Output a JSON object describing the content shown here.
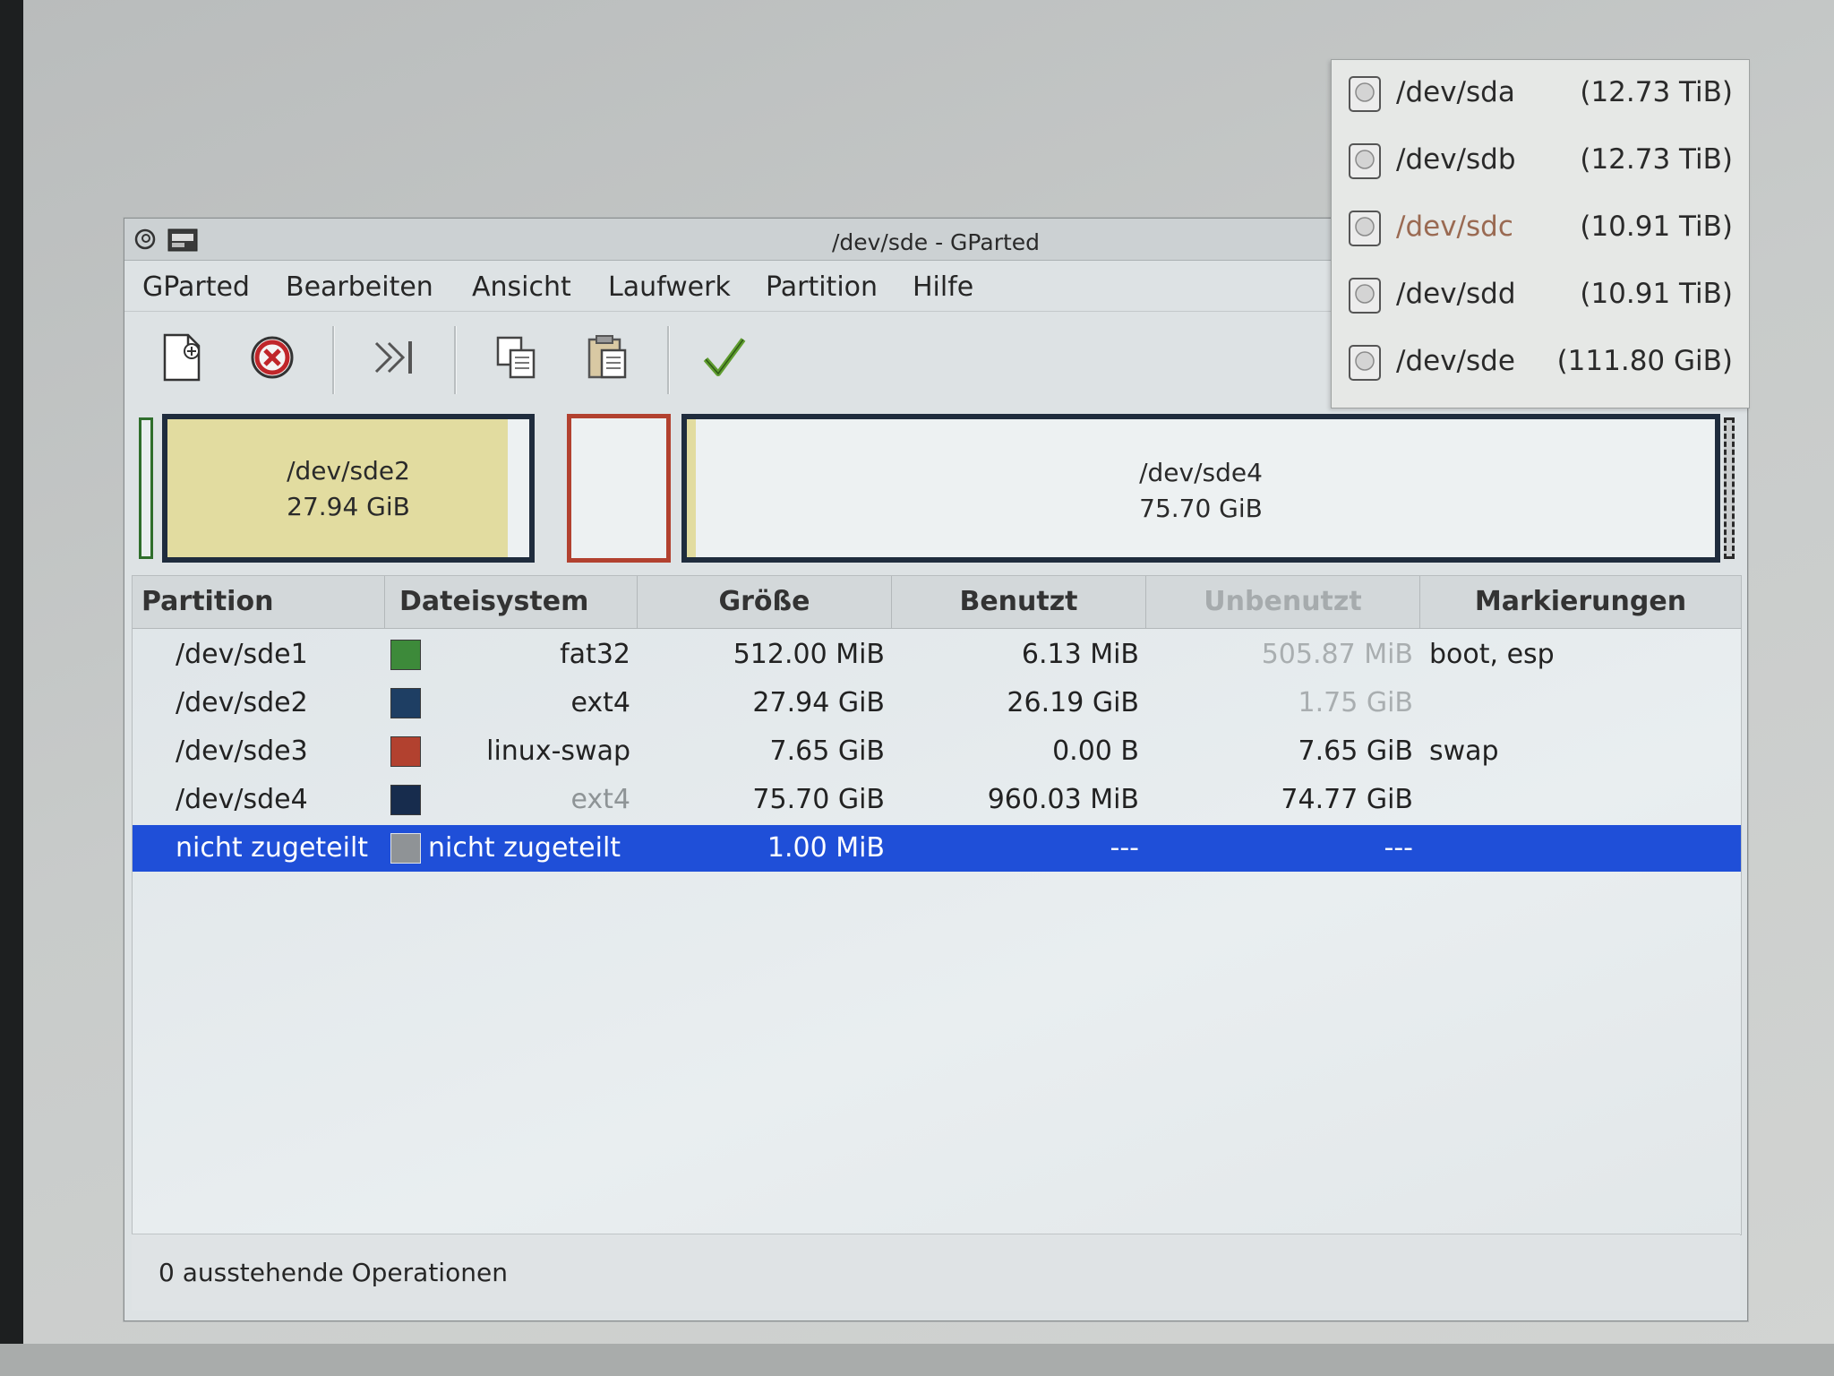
{
  "window": {
    "title": "/dev/sde - GParted"
  },
  "menu": [
    "GParted",
    "Bearbeiten",
    "Ansicht",
    "Laufwerk",
    "Partition",
    "Hilfe"
  ],
  "toolbar": {
    "buttons": [
      "new-partition-icon",
      "delete-icon",
      "apply-forward-icon",
      "copy-icon",
      "paste-icon",
      "apply-check-icon"
    ]
  },
  "diskmap": {
    "sde2": {
      "name": "/dev/sde2",
      "size": "27.94 GiB",
      "used_fraction": 0.94
    },
    "sde4": {
      "name": "/dev/sde4",
      "size": "75.70 GiB"
    }
  },
  "table": {
    "headers": [
      "Partition",
      "Dateisystem",
      "Größe",
      "Benutzt",
      "Unbenutzt",
      "Markierungen"
    ],
    "rows": [
      {
        "partition": "/dev/sde1",
        "filesystem": "fat32",
        "color": "#3d8a3a",
        "size": "512.00 MiB",
        "used": "6.13 MiB",
        "unused": "505.87 MiB",
        "flags": "boot, esp"
      },
      {
        "partition": "/dev/sde2",
        "filesystem": "ext4",
        "color": "#1e3e63",
        "size": "27.94 GiB",
        "used": "26.19 GiB",
        "unused": "1.75 GiB",
        "flags": ""
      },
      {
        "partition": "/dev/sde3",
        "filesystem": "linux-swap",
        "color": "#b2412f",
        "size": "7.65 GiB",
        "used": "0.00 B",
        "unused": "7.65 GiB",
        "flags": "swap"
      },
      {
        "partition": "/dev/sde4",
        "filesystem": "ext4",
        "color": "#172c4d",
        "size": "75.70 GiB",
        "used": "960.03 MiB",
        "unused": "74.77 GiB",
        "flags": ""
      },
      {
        "partition": "nicht zugeteilt",
        "filesystem": "nicht zugeteilt",
        "color": "#8f9396",
        "size": "1.00 MiB",
        "used": "---",
        "unused": "---",
        "flags": "",
        "selected": true
      }
    ]
  },
  "status": {
    "text": "0 ausstehende Operationen"
  },
  "devices": [
    {
      "name": "/dev/sda",
      "size": "(12.73 TiB)"
    },
    {
      "name": "/dev/sdb",
      "size": "(12.73 TiB)"
    },
    {
      "name": "/dev/sdc",
      "size": "(10.91 TiB)"
    },
    {
      "name": "/dev/sdd",
      "size": "(10.91 TiB)"
    },
    {
      "name": "/dev/sde",
      "size": "(111.80 GiB)"
    }
  ],
  "colors": {
    "selection": "#1f4fd8",
    "ext4_used": "#e2dca0",
    "partition_border": "#1f2c3d",
    "swap_border": "#b2412f"
  }
}
